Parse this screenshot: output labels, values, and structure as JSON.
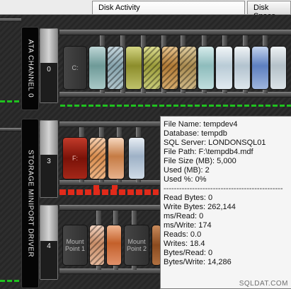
{
  "tabs": {
    "disk_activity": "Disk Activity",
    "disk_space": "Disk Space"
  },
  "channels": {
    "ata": "ATA CHANNEL 0",
    "storage": "STORAGE MINIPORT DRIVER"
  },
  "gauges": {
    "g0": "0",
    "g3": "3",
    "g4": "4"
  },
  "disks": {
    "c": "C:",
    "f": "F:",
    "mp1": "Mount Point 1",
    "mp2": "Mount Point 2"
  },
  "tooltip": {
    "file_name": "File Name: tempdev4",
    "database": "Database: tempdb",
    "sql_server": "SQL Server: LONDONSQL01",
    "file_path": "File Path: F:\\tempdb4.mdf",
    "file_size": "File Size (MB): 5,000",
    "used": "Used (MB): 2",
    "used_pct": "Used %: 0%",
    "separator": "----------------------------------------------",
    "read_bytes": "Read Bytes: 0",
    "write_bytes": "Write Bytes: 262,144",
    "ms_read": "ms/Read: 0",
    "ms_write": "ms/Write: 174",
    "reads": "Reads: 0.0",
    "writes": "Writes: 18.4",
    "bytes_read": "Bytes/Read: 0",
    "bytes_write": "Bytes/Write: 14,286"
  },
  "watermark": "SQLDAT.COM",
  "colors": {
    "tempdb_green": "#b6b95a",
    "tempdb_orange": "#dba35c",
    "tempdb_teal": "#8fbfb9",
    "tempdb_blue": "#7f9ccf",
    "log_white": "#d8dee4",
    "f_drive_red": "#9a1a10",
    "activity_green": "#1fc21f",
    "activity_red": "#e12a1a"
  }
}
